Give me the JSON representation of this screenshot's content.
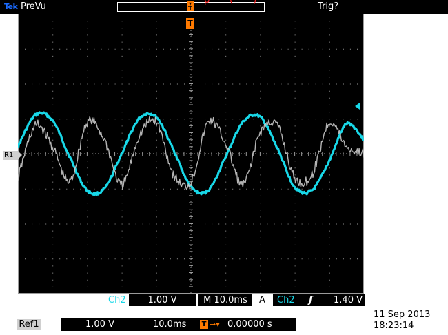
{
  "top_bar": {
    "brand": "Tek",
    "mode": "PreVu",
    "trigger_status": "Trig?",
    "trigger_marker_label": "T",
    "red_overlay_text": "p       (       )"
  },
  "screen": {
    "trigger_position_label": "T",
    "reference_marker_label": "R1",
    "colors": {
      "background": "#000000",
      "grid": "#9a9a9a",
      "ch2_trace": "#18d8e8",
      "ref1_trace": "#c8c8c8",
      "trigger_marker": "#ff7a00"
    }
  },
  "chart_data": {
    "type": "line",
    "title": "",
    "xlabel": "",
    "ylabel": "",
    "time_per_div_ms": 10.0,
    "volts_per_div": 1.0,
    "x_divisions": 10,
    "y_divisions": 8,
    "xlim_ms": [
      -50,
      50
    ],
    "ylim_v": [
      -4,
      4
    ],
    "grid": true,
    "series": [
      {
        "name": "Ch2",
        "color": "#18d8e8",
        "x_ms": [
          -50,
          -45,
          -40,
          -35,
          -30,
          -25,
          -20,
          -15,
          -10,
          -5,
          0,
          5,
          10,
          15,
          20,
          25,
          30,
          35,
          40,
          45,
          50
        ],
        "y_v": [
          0.2,
          1.1,
          0.95,
          -0.1,
          -1.05,
          -1.0,
          0.0,
          1.0,
          1.05,
          0.1,
          -0.95,
          -1.05,
          -0.1,
          0.9,
          1.05,
          0.15,
          -0.95,
          -1.05,
          -0.2,
          0.85,
          0.4
        ]
      },
      {
        "name": "Ref1",
        "color": "#c8c8c8",
        "x_ms": [
          -50,
          -45,
          -40,
          -35,
          -30,
          -25,
          -20,
          -15,
          -10,
          -5,
          0,
          5,
          10,
          15,
          20,
          25,
          30,
          35,
          40,
          45,
          50
        ],
        "y_v": [
          -0.7,
          0.8,
          0.2,
          -0.8,
          0.9,
          0.4,
          -0.9,
          0.5,
          0.9,
          -0.6,
          -0.8,
          0.9,
          0.3,
          -0.9,
          0.6,
          0.8,
          -0.7,
          -0.6,
          0.9,
          0.2,
          0.0
        ]
      }
    ]
  },
  "readouts": {
    "ch2_label": "Ch2",
    "ch2_scale": "1.00 V",
    "timebase_prefix": "M",
    "timebase": "10.0ms",
    "acquire_label": "A",
    "trigger_source": "Ch2",
    "trigger_slope_symbol": "ʃ",
    "trigger_level": "1.40 V",
    "ref1_label": "Ref1",
    "ref1_volts": "1.00 V",
    "ref1_time": "10.0ms",
    "trigger_pos_icon": "T",
    "trigger_pos_arrow": "→▾",
    "trigger_position": "0.00000 s",
    "date": "11 Sep  2013",
    "time": "18:23:14"
  }
}
